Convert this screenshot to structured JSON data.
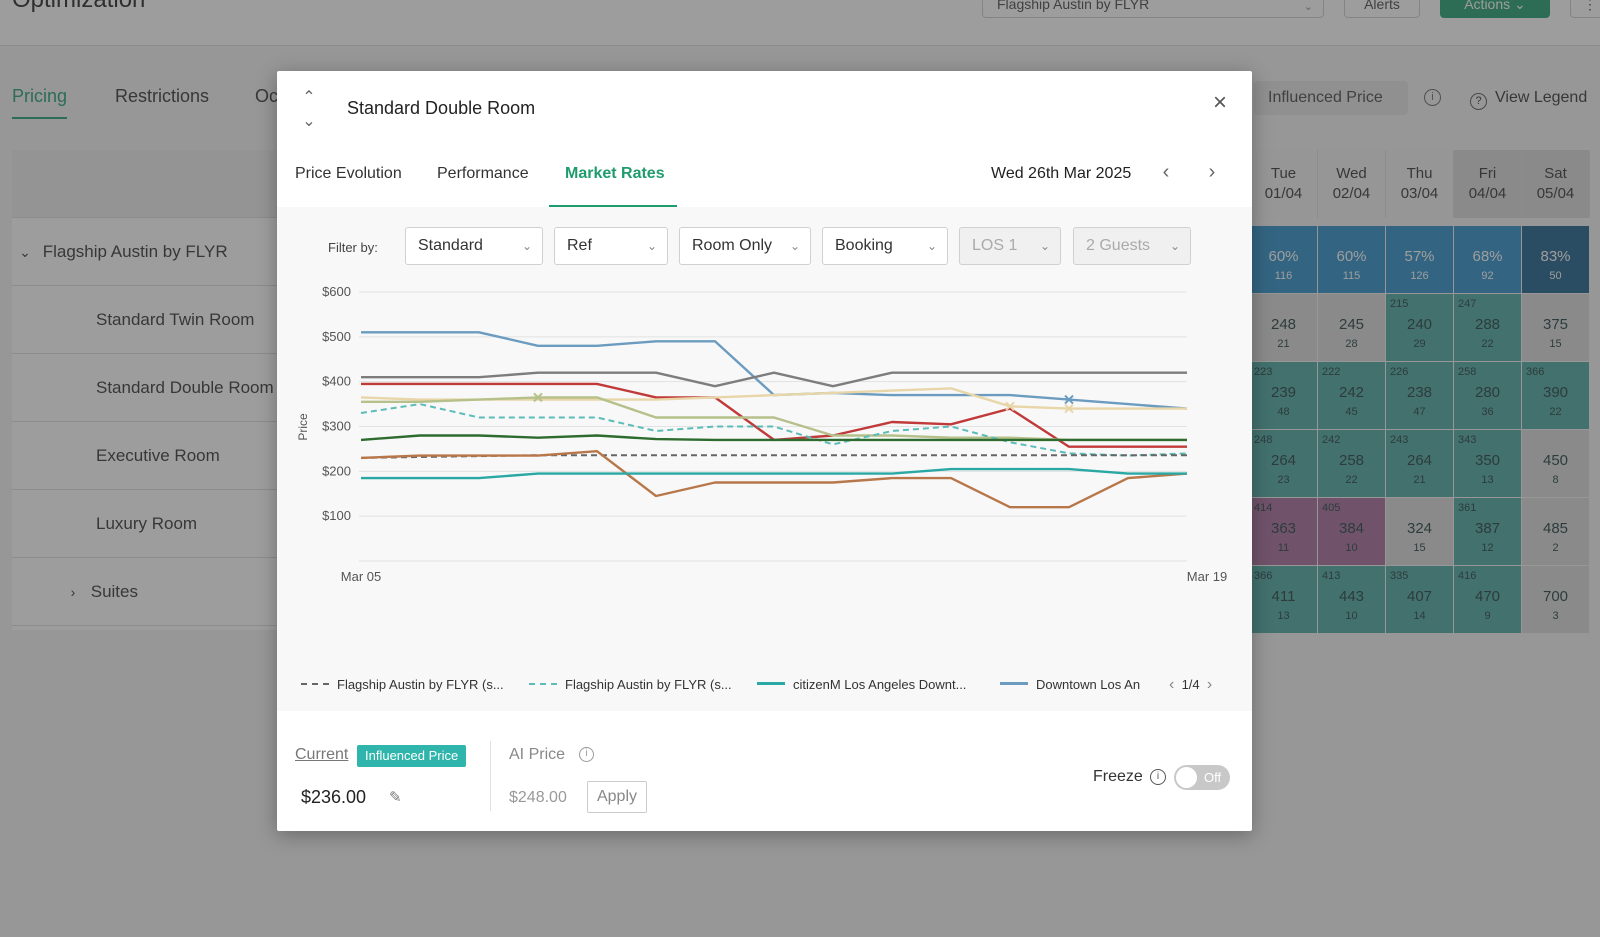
{
  "app": {
    "page_title": "Optimization",
    "hotel_select": "Flagship Austin by FLYR",
    "alerts_label": "Alerts",
    "actions_label": "Actions",
    "more_label": "⋮",
    "tabs": [
      "Pricing",
      "Restrictions",
      "Oc"
    ],
    "influenced_chip": "Influenced Price",
    "view_legend": "View Legend",
    "left_rows": [
      {
        "label": "Flagship Austin by FLYR"
      },
      {
        "label": "Standard Twin Room"
      },
      {
        "label": "Standard Double Room"
      },
      {
        "label": "Executive Room"
      },
      {
        "label": "Luxury Room"
      },
      {
        "label": "Suites"
      }
    ],
    "day_headers": [
      {
        "day": "Tue",
        "date": "01/04"
      },
      {
        "day": "Wed",
        "date": "02/04"
      },
      {
        "day": "Thu",
        "date": "03/04"
      },
      {
        "day": "Fri",
        "date": "04/04"
      },
      {
        "day": "Sat",
        "date": "05/04"
      }
    ],
    "cells": [
      [
        {
          "main": "60%",
          "sub": "116",
          "tl": ""
        },
        {
          "main": "60%",
          "sub": "115",
          "tl": ""
        },
        {
          "main": "57%",
          "sub": "126",
          "tl": ""
        },
        {
          "main": "68%",
          "sub": "92",
          "tl": ""
        },
        {
          "main": "83%",
          "sub": "50",
          "tl": ""
        }
      ],
      [
        {
          "main": "248",
          "sub": "21",
          "tl": ""
        },
        {
          "main": "245",
          "sub": "28",
          "tl": ""
        },
        {
          "main": "240",
          "sub": "29",
          "tl": "215"
        },
        {
          "main": "288",
          "sub": "22",
          "tl": "247"
        },
        {
          "main": "375",
          "sub": "15",
          "tl": ""
        }
      ],
      [
        {
          "main": "239",
          "sub": "48",
          "tl": "223"
        },
        {
          "main": "242",
          "sub": "45",
          "tl": "222"
        },
        {
          "main": "238",
          "sub": "47",
          "tl": "226"
        },
        {
          "main": "280",
          "sub": "36",
          "tl": "258"
        },
        {
          "main": "390",
          "sub": "22",
          "tl": "366"
        }
      ],
      [
        {
          "main": "264",
          "sub": "23",
          "tl": "248"
        },
        {
          "main": "258",
          "sub": "22",
          "tl": "242"
        },
        {
          "main": "264",
          "sub": "21",
          "tl": "243"
        },
        {
          "main": "350",
          "sub": "13",
          "tl": "343"
        },
        {
          "main": "450",
          "sub": "8",
          "tl": ""
        }
      ],
      [
        {
          "main": "363",
          "sub": "11",
          "tl": "414"
        },
        {
          "main": "384",
          "sub": "10",
          "tl": "405"
        },
        {
          "main": "324",
          "sub": "15",
          "tl": ""
        },
        {
          "main": "387",
          "sub": "12",
          "tl": "361"
        },
        {
          "main": "485",
          "sub": "2",
          "tl": ""
        }
      ],
      [
        {
          "main": "411",
          "sub": "13",
          "tl": "366"
        },
        {
          "main": "443",
          "sub": "10",
          "tl": "413"
        },
        {
          "main": "407",
          "sub": "14",
          "tl": "335"
        },
        {
          "main": "470",
          "sub": "9",
          "tl": "416"
        },
        {
          "main": "700",
          "sub": "3",
          "tl": ""
        }
      ]
    ]
  },
  "modal": {
    "title": "Standard Double Room",
    "tabs": [
      "Price Evolution",
      "Performance",
      "Market Rates"
    ],
    "active_tab": "Market Rates",
    "date_label": "Wed 26th Mar 2025",
    "filter_label": "Filter by:",
    "filters": [
      {
        "label": "Standard",
        "disabled": false
      },
      {
        "label": "Ref",
        "disabled": false
      },
      {
        "label": "Room Only",
        "disabled": false
      },
      {
        "label": "Booking",
        "disabled": false
      },
      {
        "label": "LOS 1",
        "disabled": true
      },
      {
        "label": "2 Guests",
        "disabled": true
      }
    ],
    "legend": [
      {
        "label": "Flagship Austin by FLYR (s...",
        "color": "#666666",
        "dashed": true
      },
      {
        "label": "Flagship Austin by FLYR (s...",
        "color": "#5bbcb8",
        "dashed": true
      },
      {
        "label": "citizenM Los Angeles Downt...",
        "color": "#2aa8a4",
        "dashed": false
      },
      {
        "label": "Downtown Los An",
        "color": "#6b9cc0",
        "dashed": false
      }
    ],
    "legend_page": "1/4",
    "footer": {
      "current_label": "Current",
      "influenced_badge": "Influenced Price",
      "current_value": "$236.00",
      "ai_label": "AI Price",
      "ai_value": "$248.00",
      "apply_label": "Apply",
      "freeze_label": "Freeze",
      "toggle_label": "Off"
    }
  },
  "chart_data": {
    "type": "line",
    "title": "",
    "xlabel": "",
    "ylabel": "Price",
    "x_tick_labels": [
      "Mar 05",
      "Mar 19"
    ],
    "y_ticks": [
      "$100",
      "$200",
      "$300",
      "$400",
      "$500",
      "$600"
    ],
    "ylim": [
      0,
      600
    ],
    "x": [
      0,
      1,
      2,
      3,
      4,
      5,
      6,
      7,
      8,
      9,
      10,
      11,
      12,
      13,
      14
    ],
    "grid": true,
    "series": [
      {
        "color": "#6b9cc0",
        "dashed": false,
        "values": [
          510,
          510,
          510,
          480,
          480,
          490,
          490,
          370,
          375,
          370,
          370,
          370,
          360,
          350,
          340
        ]
      },
      {
        "color": "#7d7d7d",
        "dashed": false,
        "values": [
          410,
          410,
          410,
          420,
          420,
          420,
          390,
          420,
          390,
          420,
          420,
          420,
          420,
          420,
          420
        ]
      },
      {
        "color": "#c13a3a",
        "dashed": false,
        "values": [
          395,
          395,
          395,
          395,
          395,
          365,
          365,
          270,
          280,
          310,
          305,
          340,
          255,
          255,
          255
        ]
      },
      {
        "color": "#e8d6a8",
        "dashed": false,
        "values": [
          365,
          360,
          360,
          360,
          360,
          360,
          365,
          370,
          375,
          380,
          385,
          345,
          340,
          340,
          340
        ]
      },
      {
        "color": "#b5c08a",
        "dashed": false,
        "values": [
          355,
          355,
          360,
          365,
          365,
          320,
          320,
          320,
          280,
          280,
          275,
          275,
          270,
          270,
          270
        ]
      },
      {
        "color": "#5bbcb8",
        "dashed": true,
        "values": [
          330,
          350,
          320,
          320,
          320,
          290,
          300,
          300,
          260,
          290,
          300,
          265,
          240,
          235,
          240
        ]
      },
      {
        "color": "#2e6b2e",
        "dashed": false,
        "values": [
          270,
          280,
          280,
          275,
          280,
          272,
          270,
          270,
          270,
          270,
          270,
          270,
          270,
          270,
          270
        ]
      },
      {
        "color": "#666666",
        "dashed": true,
        "values": [
          230,
          232,
          234,
          236,
          236,
          236,
          236,
          236,
          236,
          236,
          236,
          236,
          236,
          236,
          236
        ]
      },
      {
        "color": "#b8774a",
        "dashed": false,
        "values": [
          230,
          235,
          235,
          235,
          245,
          145,
          175,
          175,
          175,
          185,
          185,
          120,
          120,
          185,
          195
        ]
      },
      {
        "color": "#2aa8a4",
        "dashed": false,
        "values": [
          185,
          185,
          185,
          195,
          195,
          195,
          195,
          195,
          195,
          195,
          205,
          205,
          205,
          195,
          195
        ]
      }
    ]
  }
}
